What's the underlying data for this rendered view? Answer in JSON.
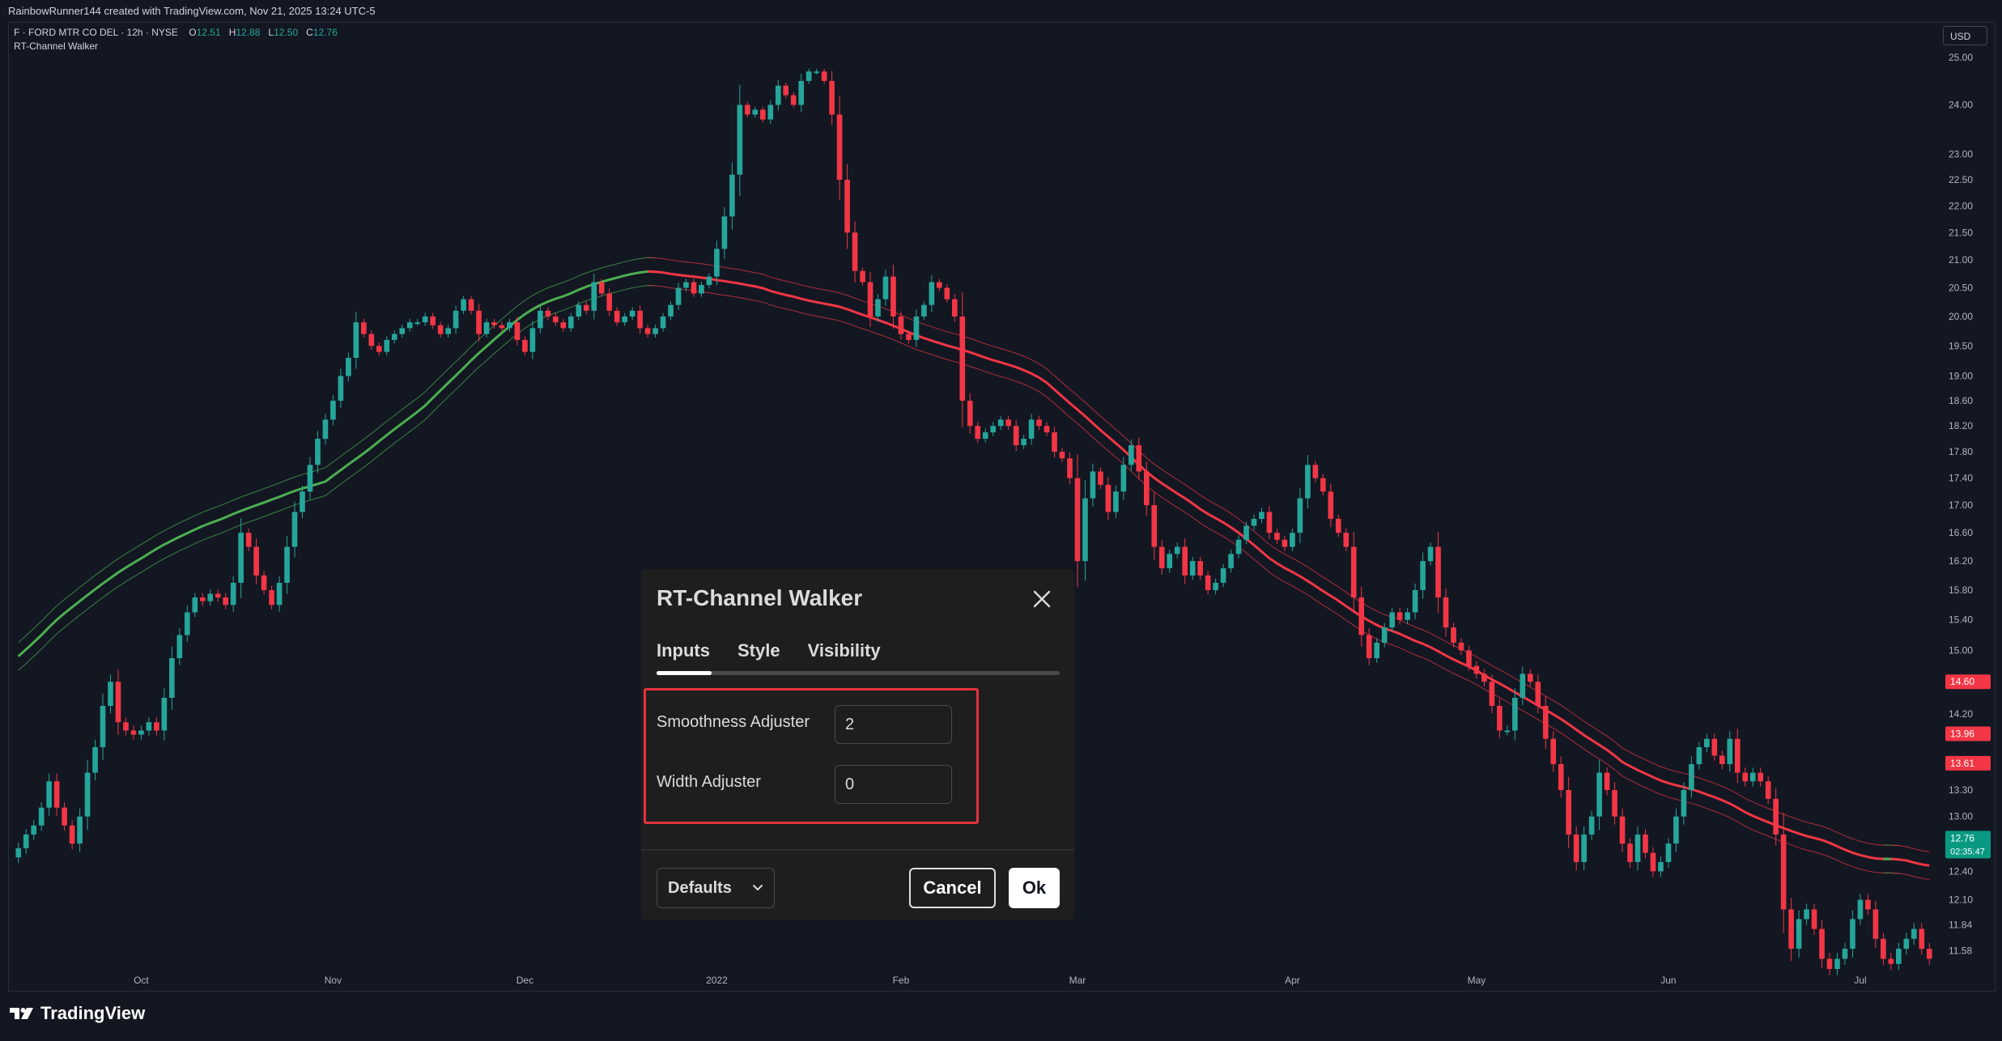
{
  "header": {
    "attribution": "RainbowRunner144 created with TradingView.com, Nov 21, 2025 13:24 UTC-5"
  },
  "legend": {
    "symbol": "F · FORD MTR CO DEL · 12h · NYSE",
    "o_label": "O",
    "o_value": "12.51",
    "h_label": "H",
    "h_value": "12.88",
    "l_label": "L",
    "l_value": "12.50",
    "c_label": "C",
    "c_value": "12.76",
    "indicator": "RT-Channel Walker"
  },
  "currency": "USD",
  "brand": "TradingView",
  "colors": {
    "background": "#131722",
    "up": "#26a69a",
    "down": "#f23645",
    "channel_up": "#4caf50",
    "channel_down": "#f23645",
    "dialog_bg": "#1e1e1e",
    "highlight": "#e5323d"
  },
  "dialog": {
    "title": "RT-Channel Walker",
    "tabs": [
      "Inputs",
      "Style",
      "Visibility"
    ],
    "active_tab": "Inputs",
    "fields": [
      {
        "label": "Smoothness Adjuster",
        "value": "2"
      },
      {
        "label": "Width Adjuster",
        "value": "0"
      }
    ],
    "defaults_label": "Defaults",
    "cancel_label": "Cancel",
    "ok_label": "Ok"
  },
  "chart_data": {
    "type": "candlestick",
    "symbol": "F",
    "interval": "12h",
    "ylim": [
      11.4,
      25.6
    ],
    "price_ticks": [
      25.0,
      24.0,
      23.0,
      22.5,
      22.0,
      21.5,
      21.0,
      20.5,
      20.0,
      19.5,
      19.0,
      18.6,
      18.2,
      17.8,
      17.4,
      17.0,
      16.6,
      16.2,
      15.8,
      15.4,
      15.0,
      14.2,
      13.3,
      13.0,
      12.4,
      12.1,
      11.84,
      11.58
    ],
    "price_tick_labels": [
      "25.00",
      "24.00",
      "23.00",
      "22.50",
      "22.00",
      "21.50",
      "21.00",
      "20.50",
      "20.00",
      "19.50",
      "19.00",
      "18.60",
      "18.20",
      "17.80",
      "17.40",
      "17.00",
      "16.60",
      "16.20",
      "15.80",
      "15.40",
      "15.00",
      "14.20",
      "13.30",
      "13.00",
      "12.40",
      "12.10",
      "11.84",
      "11.58"
    ],
    "time_labels": [
      "Oct",
      "Nov",
      "Dec",
      "2022",
      "Feb",
      "Mar",
      "Apr",
      "May",
      "Jun",
      "Jul"
    ],
    "time_label_bar": [
      16,
      41,
      66,
      91,
      115,
      138,
      166,
      190,
      215,
      240
    ],
    "price_badges": [
      {
        "value": 14.6,
        "label": "14.60",
        "color": "#f23645"
      },
      {
        "value": 13.96,
        "label": "13.96",
        "color": "#f23645"
      },
      {
        "value": 13.61,
        "label": "13.61",
        "color": "#f23645"
      },
      {
        "value": 12.76,
        "label": "12.76",
        "color": "#089981",
        "sub": "02:35:47"
      }
    ],
    "closes": [
      12.65,
      12.8,
      12.9,
      13.1,
      13.4,
      13.1,
      12.9,
      12.7,
      13.0,
      13.5,
      13.8,
      14.3,
      14.6,
      14.1,
      14.0,
      13.95,
      14.0,
      14.1,
      14.0,
      14.4,
      14.9,
      15.2,
      15.5,
      15.7,
      15.65,
      15.75,
      15.7,
      15.6,
      15.9,
      16.6,
      16.4,
      16.0,
      15.8,
      15.6,
      15.9,
      16.4,
      16.9,
      17.2,
      17.6,
      18.0,
      18.3,
      18.6,
      19.0,
      19.3,
      19.9,
      19.7,
      19.5,
      19.4,
      19.6,
      19.7,
      19.8,
      19.9,
      19.9,
      20.0,
      19.85,
      19.7,
      19.8,
      20.1,
      20.3,
      20.1,
      19.7,
      19.9,
      19.85,
      19.8,
      19.9,
      19.6,
      19.4,
      19.8,
      20.1,
      20.0,
      19.9,
      19.8,
      20.0,
      20.2,
      20.1,
      20.6,
      20.4,
      20.1,
      19.9,
      20.0,
      20.1,
      19.8,
      19.7,
      19.8,
      20.0,
      20.2,
      20.5,
      20.6,
      20.4,
      20.55,
      20.7,
      21.2,
      21.8,
      22.6,
      24.0,
      23.8,
      23.9,
      23.7,
      24.0,
      24.4,
      24.2,
      24.0,
      24.5,
      24.7,
      24.7,
      24.5,
      23.8,
      22.5,
      21.5,
      20.8,
      20.6,
      20.0,
      20.3,
      20.7,
      20.0,
      19.7,
      19.6,
      20.0,
      20.2,
      20.6,
      20.5,
      20.3,
      20.0,
      18.6,
      18.2,
      18.0,
      18.1,
      18.2,
      18.3,
      18.2,
      17.9,
      18.0,
      18.3,
      18.2,
      18.1,
      17.8,
      17.7,
      17.4,
      16.2,
      17.1,
      17.5,
      17.3,
      16.9,
      17.2,
      17.6,
      17.9,
      17.5,
      17.0,
      16.4,
      16.1,
      16.3,
      16.4,
      16.0,
      16.2,
      16.0,
      15.8,
      15.9,
      16.1,
      16.3,
      16.5,
      16.7,
      16.8,
      16.9,
      16.6,
      16.5,
      16.4,
      16.6,
      17.1,
      17.6,
      17.4,
      17.2,
      16.8,
      16.6,
      16.4,
      15.7,
      15.2,
      14.9,
      15.1,
      15.3,
      15.5,
      15.4,
      15.5,
      15.8,
      16.2,
      16.4,
      15.7,
      15.3,
      15.1,
      15.0,
      14.8,
      14.7,
      14.6,
      14.3,
      14.0,
      14.0,
      14.4,
      14.7,
      14.6,
      14.3,
      13.9,
      13.6,
      13.3,
      12.8,
      12.5,
      12.8,
      13.0,
      13.5,
      13.3,
      13.0,
      12.7,
      12.5,
      12.8,
      12.6,
      12.4,
      12.5,
      12.7,
      13.0,
      13.3,
      13.6,
      13.8,
      13.9,
      13.7,
      13.6,
      13.9,
      13.5,
      13.4,
      13.5,
      13.4,
      13.2,
      12.8,
      12.0,
      11.6,
      11.9,
      12.0,
      11.8,
      11.5,
      11.4,
      11.5,
      11.6,
      11.9,
      12.1,
      12.0,
      11.7,
      11.5,
      11.45,
      11.6,
      11.7,
      11.8,
      11.6,
      11.5
    ]
  }
}
